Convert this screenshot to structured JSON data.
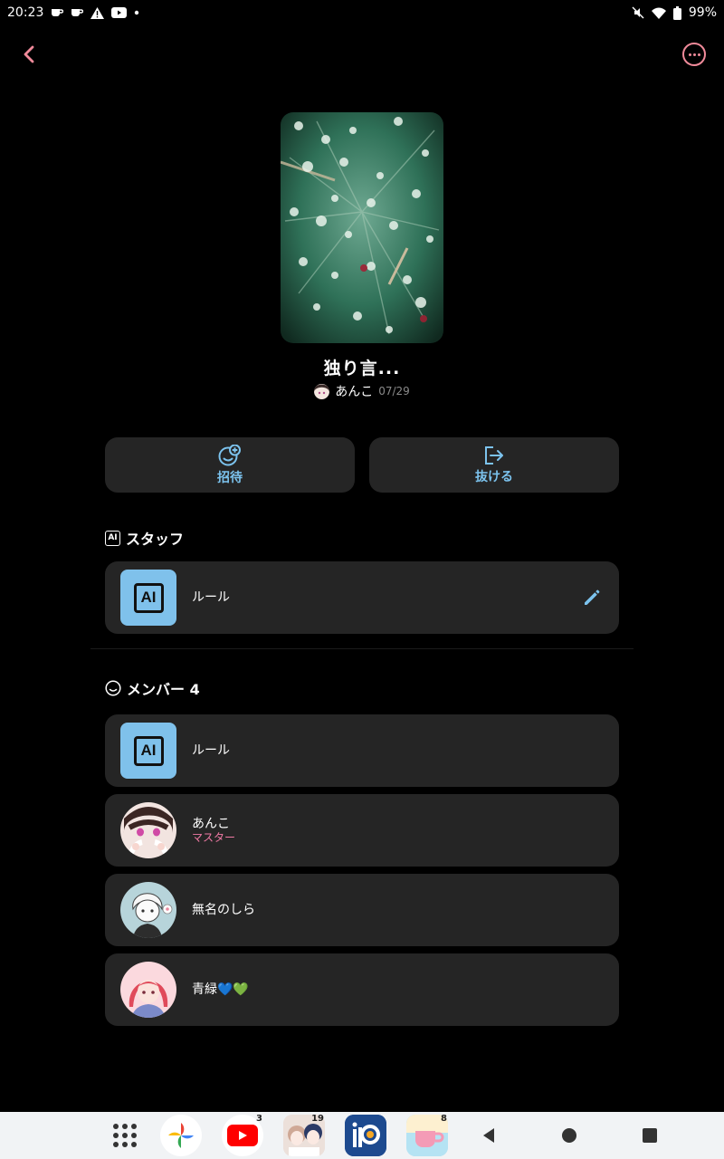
{
  "status_bar": {
    "time": "20:23",
    "battery": "99%",
    "icons_left": [
      "coffee-icon",
      "coffee-icon",
      "warning-icon",
      "youtube-icon",
      "dot-icon"
    ],
    "icons_right": [
      "mute-icon",
      "wifi-icon",
      "battery-icon"
    ]
  },
  "room": {
    "title": "独り言...",
    "owner_name": "あんこ",
    "date": "07/29"
  },
  "actions": {
    "invite_label": "招待",
    "leave_label": "抜ける"
  },
  "staff": {
    "heading": "スタッフ",
    "items": [
      {
        "name": "ルール",
        "icon": "ai-icon"
      }
    ]
  },
  "members": {
    "heading": "メンバー 4",
    "items": [
      {
        "name": "ルール",
        "role": ""
      },
      {
        "name": "あんこ",
        "role": "マスター"
      },
      {
        "name": "無名のしら",
        "role": ""
      },
      {
        "name": "青緑💙💚",
        "role": ""
      }
    ]
  },
  "dock": {
    "items": [
      {
        "name": "apps-grid-icon",
        "badge": ""
      },
      {
        "name": "google-photos-icon",
        "badge": ""
      },
      {
        "name": "youtube-icon",
        "badge": "3"
      },
      {
        "name": "dress-up-game-icon",
        "badge": "19"
      },
      {
        "name": "ibispaint-icon",
        "badge": ""
      },
      {
        "name": "cup-app-icon",
        "badge": "8"
      }
    ],
    "nav": [
      "back-triangle-icon",
      "home-circle-icon",
      "recents-square-icon"
    ]
  },
  "colors": {
    "accent_pink": "#f08a9a",
    "accent_blue": "#7cc3ee",
    "card_bg": "#252525",
    "ai_tile": "#7fc1eb",
    "role_pink": "#f07aa5"
  }
}
